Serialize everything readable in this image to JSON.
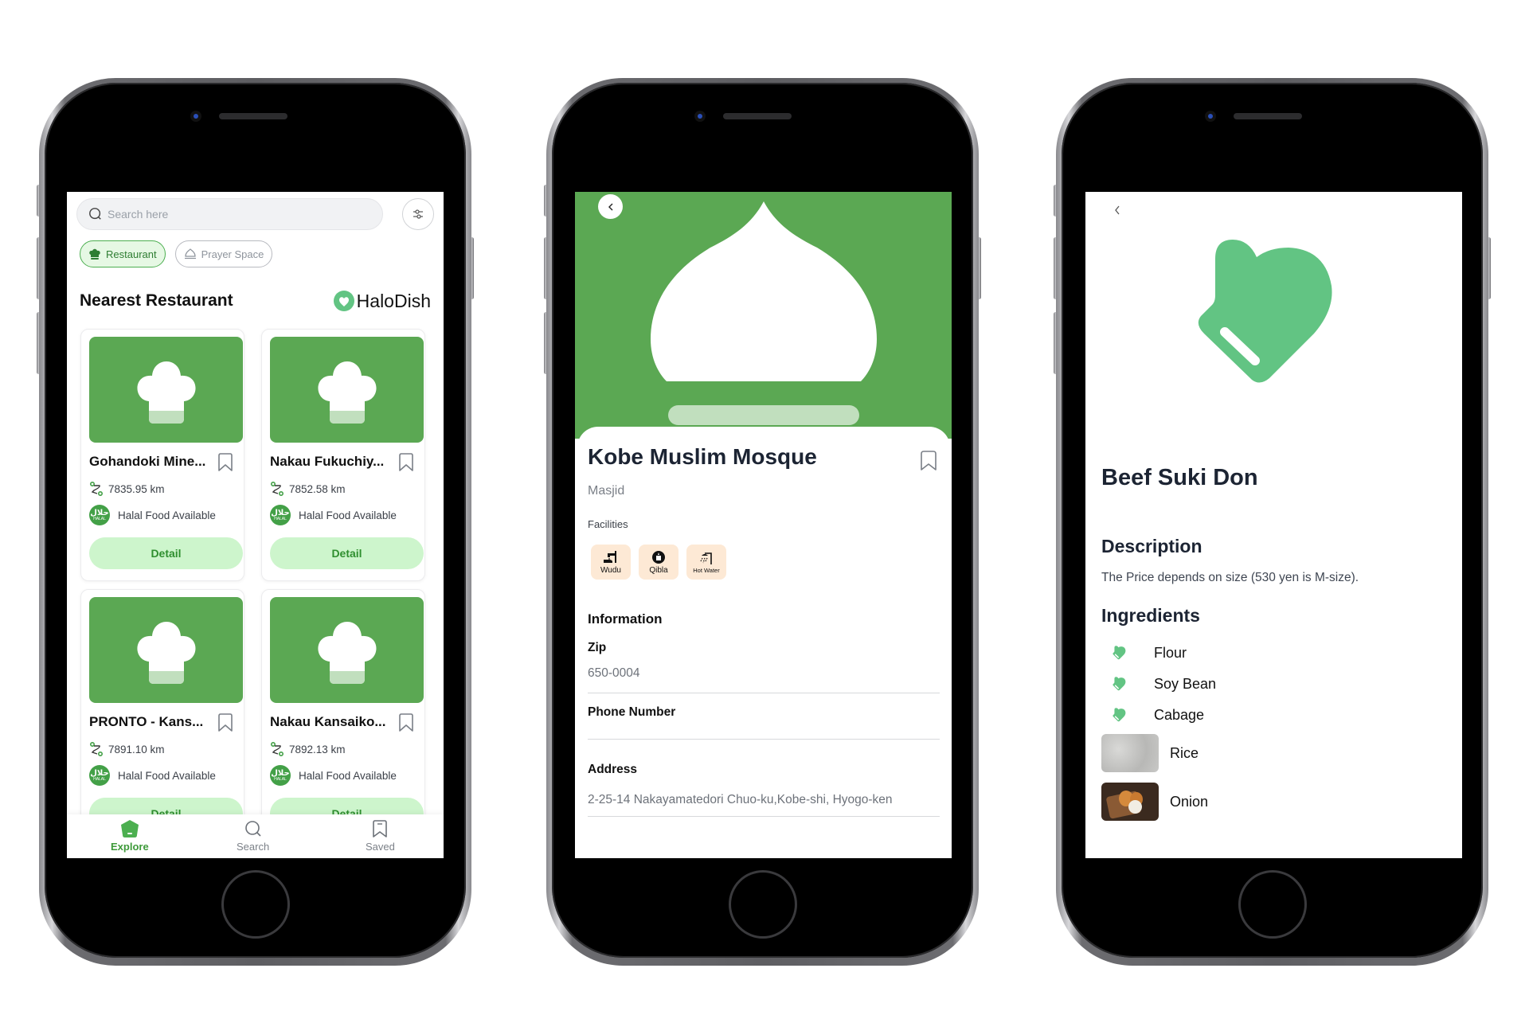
{
  "colors": {
    "brand_green": "#5ba853",
    "accent_green": "#3e9a3a",
    "light_green": "#cdf5cc",
    "mint_icon": "#62c483",
    "facility_bg": "#fde9d5",
    "heading": "#1c2433"
  },
  "explore_screen": {
    "search": {
      "placeholder": "Search here",
      "icon": "search-icon"
    },
    "filter_icon": "sliders-icon",
    "chips": [
      {
        "label": "Restaurant",
        "icon": "chef-hat-icon",
        "active": true
      },
      {
        "label": "Prayer Space",
        "icon": "dome-icon",
        "active": false
      }
    ],
    "section_title": "Nearest Restaurant",
    "logo_text": "HaloDish",
    "restaurants": [
      {
        "name": "Gohandoki Mine...",
        "distance": "7835.95 km",
        "halal": "Halal Food Available",
        "button": "Detail"
      },
      {
        "name": "Nakau Fukuchiy...",
        "distance": "7852.58 km",
        "halal": "Halal Food Available",
        "button": "Detail"
      },
      {
        "name": "PRONTO - Kans...",
        "distance": "7891.10 km",
        "halal": "Halal Food Available",
        "button": "Detail"
      },
      {
        "name": "Nakau Kansaiko...",
        "distance": "7892.13 km",
        "halal": "Halal Food Available",
        "button": "Detail"
      }
    ],
    "halal_badge": {
      "arabic": "حلال",
      "latin": "HALAL"
    },
    "bottom_nav": [
      {
        "label": "Explore",
        "icon": "home-icon",
        "active": true
      },
      {
        "label": "Search",
        "icon": "search-icon",
        "active": false
      },
      {
        "label": "Saved",
        "icon": "bookmark-icon",
        "active": false
      }
    ]
  },
  "mosque_screen": {
    "title": "Kobe Muslim Mosque",
    "subtitle": "Masjid",
    "facilities_label": "Facilities",
    "facilities": [
      {
        "label": "Wudu",
        "icon": "wudu-icon"
      },
      {
        "label": "Qibla",
        "icon": "qibla-icon"
      },
      {
        "label": "Hot Water",
        "icon": "shower-icon"
      }
    ],
    "info_heading": "Information",
    "fields": [
      {
        "label": "Zip",
        "value": "650-0004"
      },
      {
        "label": "Phone Number",
        "value": ""
      },
      {
        "label": "Address",
        "value": "2-25-14 Nakayamatedori Chuo-ku,Kobe-shi, Hyogo-ken"
      }
    ]
  },
  "dish_screen": {
    "title": "Beef Suki Don",
    "description_heading": "Description",
    "description": "The Price depends on size (530 yen is M-size).",
    "ingredients_heading": "Ingredients",
    "ingredients": [
      {
        "name": "Flour",
        "thumb": "mitten-icon"
      },
      {
        "name": "Soy Bean",
        "thumb": "mitten-icon"
      },
      {
        "name": "Cabage",
        "thumb": "mitten-icon"
      },
      {
        "name": "Rice",
        "thumb": "rice-photo"
      },
      {
        "name": "Onion",
        "thumb": "onion-photo"
      }
    ]
  }
}
